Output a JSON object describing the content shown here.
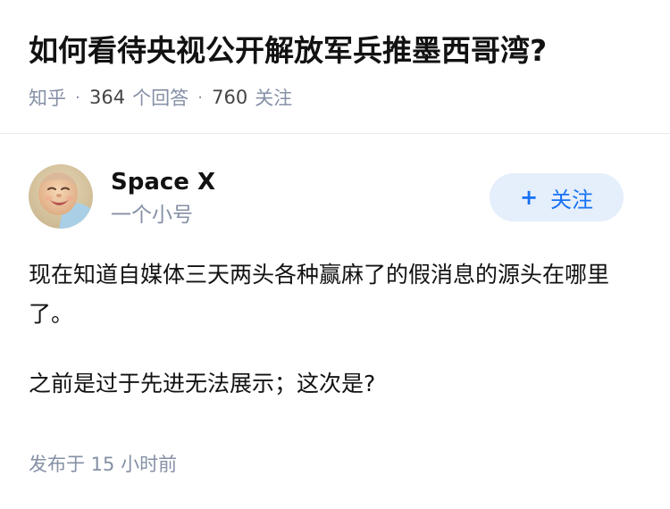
{
  "question": {
    "title": "如何看待央视公开解放军兵推墨西哥湾?",
    "source": "知乎",
    "separator": "·",
    "answer_count": "364",
    "answer_word": "个回答",
    "follower_count": "760",
    "follower_word": "关注"
  },
  "author": {
    "name": "Space X",
    "bio": "一个小号",
    "avatar_icon": "baby-photo-avatar",
    "follow_plus": "+",
    "follow_label": "关注"
  },
  "answer": {
    "paragraphs": [
      "现在知道自媒体三天两头各种赢麻了的假消息的源头在哪里了。",
      "之前是过于先进无法展示；这次是?"
    ],
    "published": "发布于 15 小时前"
  },
  "colors": {
    "accent": "#1772f6",
    "follow_bg": "#e5eefb",
    "meta_gray": "#8590a6",
    "text": "#121212"
  }
}
